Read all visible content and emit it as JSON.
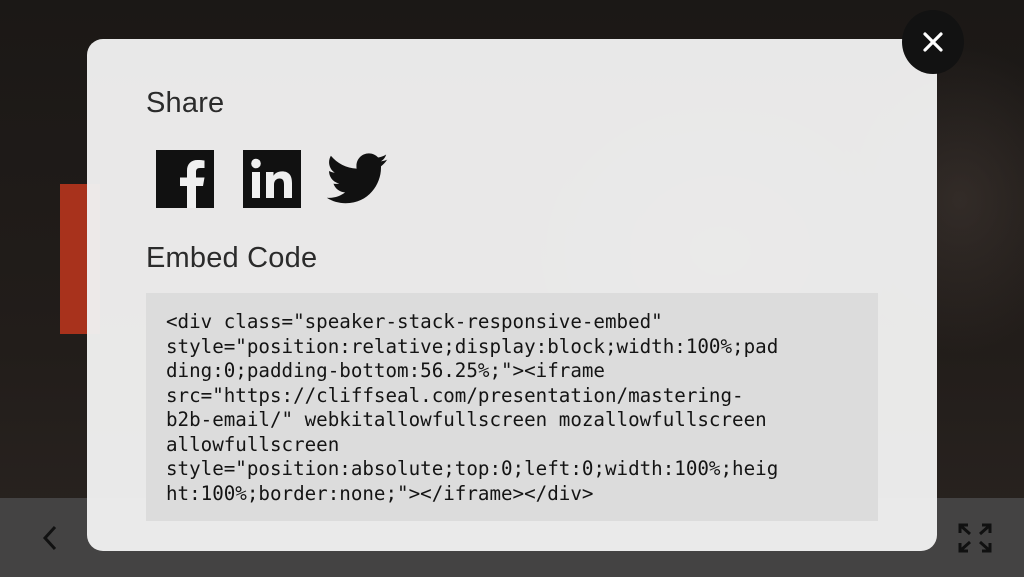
{
  "modal": {
    "share_title": "Share",
    "embed_title": "Embed Code",
    "social": [
      {
        "name": "facebook-icon"
      },
      {
        "name": "linkedin-icon"
      },
      {
        "name": "twitter-icon"
      }
    ],
    "embed_code_lines": [
      "<div class=\"speaker-stack-responsive-embed\"",
      "style=\"position:relative;display:block;width:100%;pad",
      "ding:0;padding-bottom:56.25%;\"><iframe",
      "src=\"https://cliffseal.com/presentation/mastering-",
      "b2b-email/\" webkitallowfullscreen mozallowfullscreen",
      "allowfullscreen",
      "style=\"position:absolute;top:0;left:0;width:100%;heig",
      "ht:100%;border:none;\"></iframe></div>"
    ]
  },
  "icons": {
    "close": "close-icon",
    "previous": "chevron-left-icon",
    "fullscreen": "fullscreen-icon"
  },
  "colors": {
    "modal_bg": "#f0f0f0",
    "code_bg": "#dcdcdc",
    "icon": "#111111",
    "close_bg": "#121212"
  }
}
